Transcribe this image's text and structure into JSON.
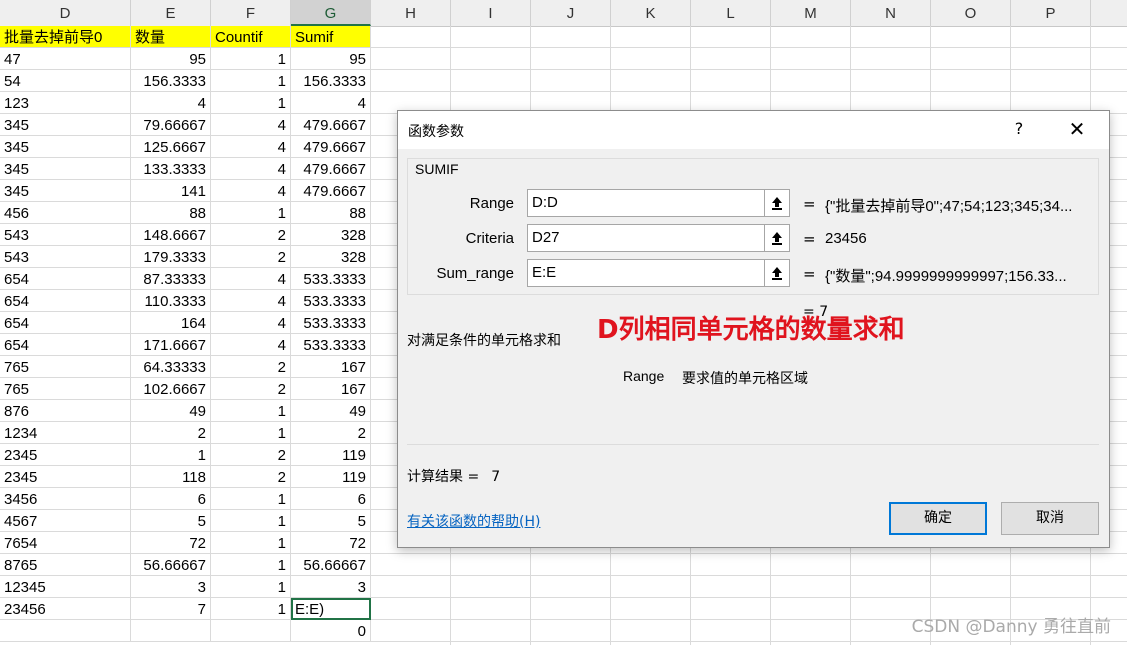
{
  "columns": [
    "D",
    "E",
    "F",
    "G",
    "H",
    "I",
    "J",
    "K",
    "L",
    "M",
    "N",
    "O",
    "P"
  ],
  "header_row": {
    "d": "批量去掉前导0",
    "e": "数量",
    "f": "Countif",
    "g": "Sumif"
  },
  "rows": [
    {
      "d": "47",
      "e": "95",
      "f": "1",
      "g": "95"
    },
    {
      "d": "54",
      "e": "156.3333",
      "f": "1",
      "g": "156.3333"
    },
    {
      "d": "123",
      "e": "4",
      "f": "1",
      "g": "4"
    },
    {
      "d": "345",
      "e": "79.66667",
      "f": "4",
      "g": "479.6667"
    },
    {
      "d": "345",
      "e": "125.6667",
      "f": "4",
      "g": "479.6667"
    },
    {
      "d": "345",
      "e": "133.3333",
      "f": "4",
      "g": "479.6667"
    },
    {
      "d": "345",
      "e": "141",
      "f": "4",
      "g": "479.6667"
    },
    {
      "d": "456",
      "e": "88",
      "f": "1",
      "g": "88"
    },
    {
      "d": "543",
      "e": "148.6667",
      "f": "2",
      "g": "328"
    },
    {
      "d": "543",
      "e": "179.3333",
      "f": "2",
      "g": "328"
    },
    {
      "d": "654",
      "e": "87.33333",
      "f": "4",
      "g": "533.3333"
    },
    {
      "d": "654",
      "e": "110.3333",
      "f": "4",
      "g": "533.3333"
    },
    {
      "d": "654",
      "e": "164",
      "f": "4",
      "g": "533.3333"
    },
    {
      "d": "654",
      "e": "171.6667",
      "f": "4",
      "g": "533.3333"
    },
    {
      "d": "765",
      "e": "64.33333",
      "f": "2",
      "g": "167"
    },
    {
      "d": "765",
      "e": "102.6667",
      "f": "2",
      "g": "167"
    },
    {
      "d": "876",
      "e": "49",
      "f": "1",
      "g": "49"
    },
    {
      "d": "1234",
      "e": "2",
      "f": "1",
      "g": "2"
    },
    {
      "d": "2345",
      "e": "1",
      "f": "2",
      "g": "119"
    },
    {
      "d": "2345",
      "e": "118",
      "f": "2",
      "g": "119"
    },
    {
      "d": "3456",
      "e": "6",
      "f": "1",
      "g": "6"
    },
    {
      "d": "4567",
      "e": "5",
      "f": "1",
      "g": "5"
    },
    {
      "d": "7654",
      "e": "72",
      "f": "1",
      "g": "72"
    },
    {
      "d": "8765",
      "e": "56.66667",
      "f": "1",
      "g": "56.66667"
    },
    {
      "d": "12345",
      "e": "3",
      "f": "1",
      "g": "3"
    },
    {
      "d": "23456",
      "e": "7",
      "f": "1",
      "g": "E:E)"
    },
    {
      "d": "",
      "e": "",
      "f": "",
      "g": "0"
    }
  ],
  "dialog": {
    "title": "函数参数",
    "help": "?",
    "close": "✕",
    "function_name": "SUMIF",
    "args": [
      {
        "label": "Range",
        "value": "D:D",
        "result": "{\"批量去掉前导0\";47;54;123;345;34..."
      },
      {
        "label": "Criteria",
        "value": "D27",
        "result": "23456"
      },
      {
        "label": "Sum_range",
        "value": "E:E",
        "result": "{\"数量\";94.9999999999997;156.33..."
      }
    ],
    "equals": "=",
    "formula_result": "7",
    "description": "对满足条件的单元格求和",
    "overlay_text": "D列相同单元格的数量求和",
    "param_name": "Range",
    "param_desc": "要求值的单元格区域",
    "calc_label": "计算结果 =",
    "calc_value": "7",
    "help_link": "有关该函数的帮助(H)",
    "ok": "确定",
    "cancel": "取消"
  },
  "watermark": "CSDN @Danny 勇往直前"
}
